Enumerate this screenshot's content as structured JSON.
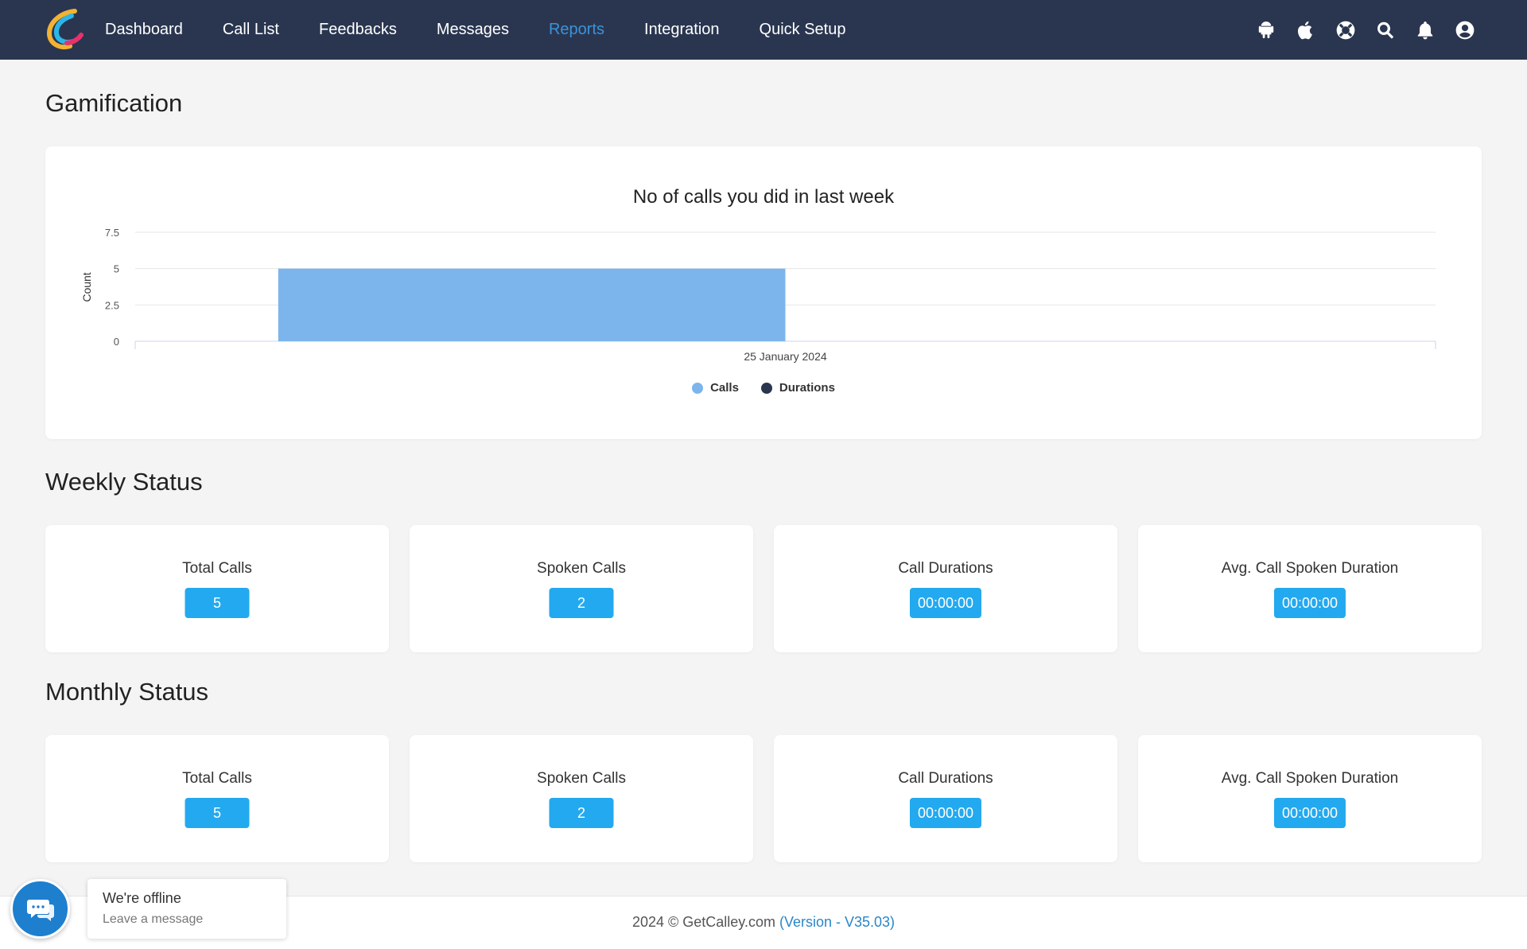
{
  "nav": {
    "links": [
      "Dashboard",
      "Call List",
      "Feedbacks",
      "Messages",
      "Reports",
      "Integration",
      "Quick Setup"
    ],
    "active": "Reports",
    "icons": [
      "android-icon",
      "apple-icon",
      "help-lifebuoy-icon",
      "search-icon",
      "bell-icon",
      "user-account-icon"
    ]
  },
  "gamification": {
    "title": "Gamification"
  },
  "chart_data": {
    "type": "bar",
    "title": "No of calls you did in last week",
    "ylabel": "Count",
    "xlabel": "",
    "categories": [
      "25 January 2024"
    ],
    "series": [
      {
        "name": "Calls",
        "values": [
          5
        ],
        "color": "#7cb5ec"
      },
      {
        "name": "Durations",
        "values": [
          0
        ],
        "color": "#2a3650"
      }
    ],
    "yticks": [
      "0",
      "2.5",
      "5",
      "7.5"
    ],
    "ylim": [
      0,
      7.5
    ],
    "grid": true,
    "legend_position": "bottom-center"
  },
  "weekly": {
    "title": "Weekly Status",
    "stats": [
      {
        "label": "Total Calls",
        "value": "5"
      },
      {
        "label": "Spoken Calls",
        "value": "2"
      },
      {
        "label": "Call Durations",
        "value": "00:00:00"
      },
      {
        "label": "Avg. Call Spoken Duration",
        "value": "00:00:00"
      }
    ]
  },
  "monthly": {
    "title": "Monthly Status",
    "stats": [
      {
        "label": "Total Calls",
        "value": "5"
      },
      {
        "label": "Spoken Calls",
        "value": "2"
      },
      {
        "label": "Call Durations",
        "value": "00:00:00"
      },
      {
        "label": "Avg. Call Spoken Duration",
        "value": "00:00:00"
      }
    ]
  },
  "footer": {
    "copyright": "2024 © GetCalley.com",
    "version": "(Version - V35.03)"
  },
  "chat": {
    "status": "We're offline",
    "action": "Leave a message"
  },
  "colors": {
    "navbar": "#2a3650",
    "accent": "#3b93d9",
    "badge": "#23a9ef",
    "bar": "#7cb5ec"
  }
}
